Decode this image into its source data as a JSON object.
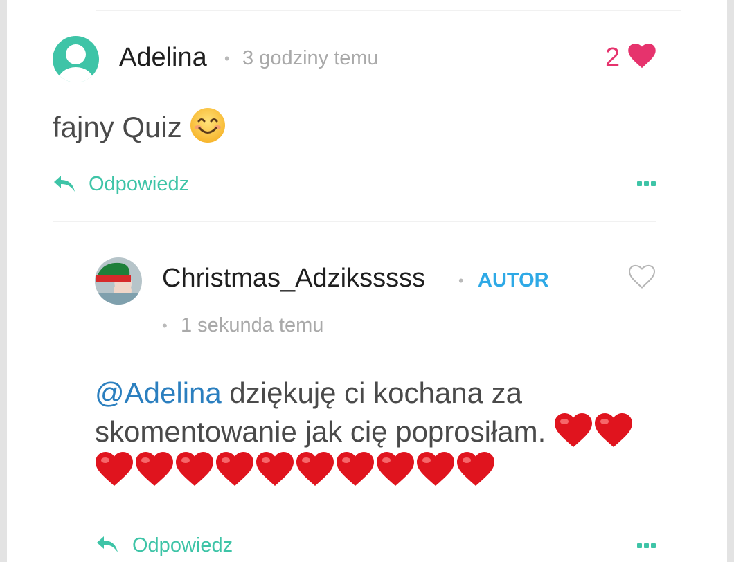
{
  "comments": [
    {
      "author": "Adelina",
      "separator": "•",
      "time": "3 godziny temu",
      "likes": "2",
      "body": "fajny Quiz",
      "body_emoji": "smiling-face-icon",
      "reply_label": "Odpowiedz"
    },
    {
      "author": "Christmas_Adziksssss",
      "separator": "•",
      "badge": "AUTOR",
      "time_separator": "•",
      "time": "1 sekunda temu",
      "mention": "@Adelina",
      "body": " dziękuję ci kochana za skomentowanie jak cię poprosiłam. ",
      "hearts_count": 12,
      "reply_label": "Odpowiedz"
    }
  ],
  "colors": {
    "accent": "#3ec4a7",
    "like_active": "#e6336d",
    "author_badge": "#2ea9e6",
    "mention": "#2b7fbf"
  }
}
